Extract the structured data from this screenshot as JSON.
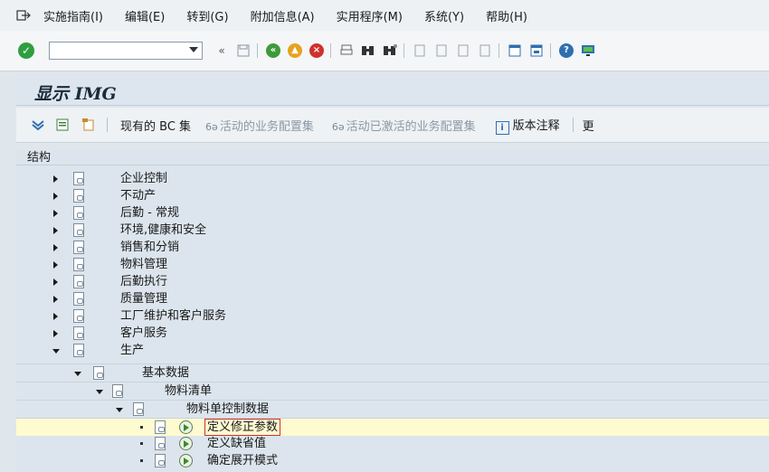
{
  "menubar": {
    "items": [
      "实施指南(I)",
      "编辑(E)",
      "转到(G)",
      "附加信息(A)",
      "实用程序(M)",
      "系统(Y)",
      "帮助(H)"
    ]
  },
  "toolbar": {
    "command_value": "",
    "back_symbol": "«"
  },
  "title": "显示 IMG",
  "app_toolbar": {
    "existing_bc_sets": "现有的 BC 集",
    "active_bc_sets": "活动的业务配置集",
    "activated_bc_sets": "活动已激活的业务配置集",
    "release_notes": "版本注释",
    "more": "更"
  },
  "tree": {
    "header": "结构",
    "level0": [
      "企业控制",
      "不动产",
      "后勤 - 常规",
      "环境,健康和安全",
      "销售和分销",
      "物料管理",
      "后勤执行",
      "质量管理",
      "工厂维护和客户服务",
      "客户服务"
    ],
    "production": "生产",
    "basic_data": "基本数据",
    "bom": "物料清单",
    "bom_control": "物料单控制数据",
    "activities": [
      "定义修正参数",
      "定义缺省值",
      "确定展开模式"
    ]
  },
  "colors": {
    "background": "#dfe6ec",
    "focus_row": "#fffbd0",
    "selection_border": "#d0312d"
  }
}
